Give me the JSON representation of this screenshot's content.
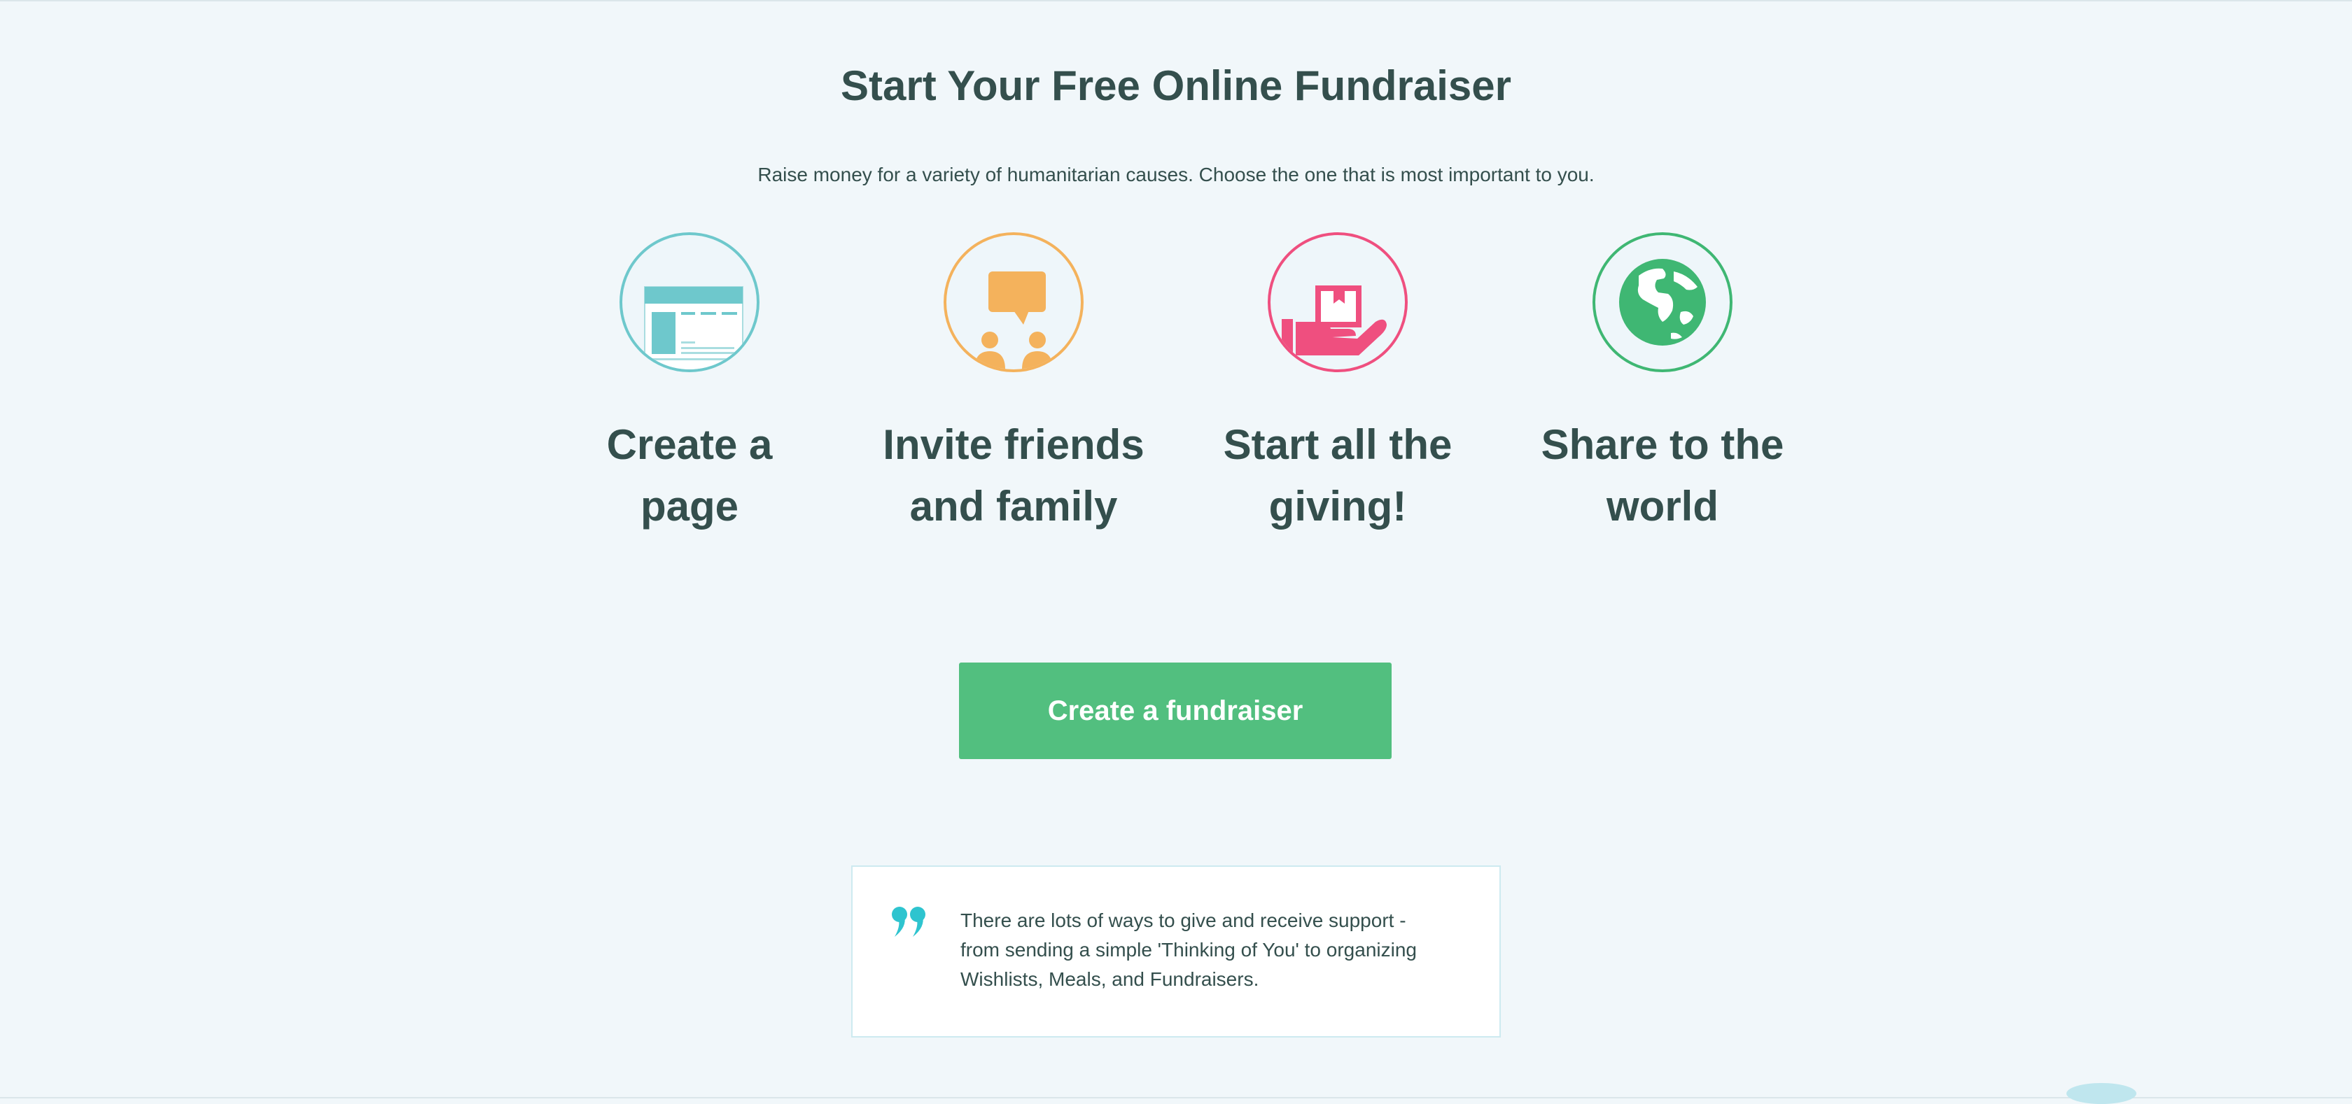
{
  "header": {
    "title": "Start Your Free Online Fundraiser",
    "subtitle": "Raise money for a variety of humanitarian causes. Choose the one that is most important to you."
  },
  "steps": [
    {
      "label": "Create a page",
      "icon": "web-page-icon",
      "color": "#6ec8cc"
    },
    {
      "label": "Invite friends and family",
      "icon": "speech-bubble-people-icon",
      "color": "#f4b25c"
    },
    {
      "label": "Start all the giving!",
      "icon": "hand-giving-gift-icon",
      "color": "#ef4f7f"
    },
    {
      "label": "Share to the world",
      "icon": "globe-icon",
      "color": "#3fb773"
    }
  ],
  "cta": {
    "label": "Create a fundraiser",
    "color": "#52bf7f"
  },
  "testimonial": {
    "icon": "quote-icon",
    "text": "There are lots of ways to give and receive support - from sending a simple 'Thinking of You' to organizing Wishlists, Meals, and Fundraisers.",
    "accent": "#2ec4cf"
  }
}
